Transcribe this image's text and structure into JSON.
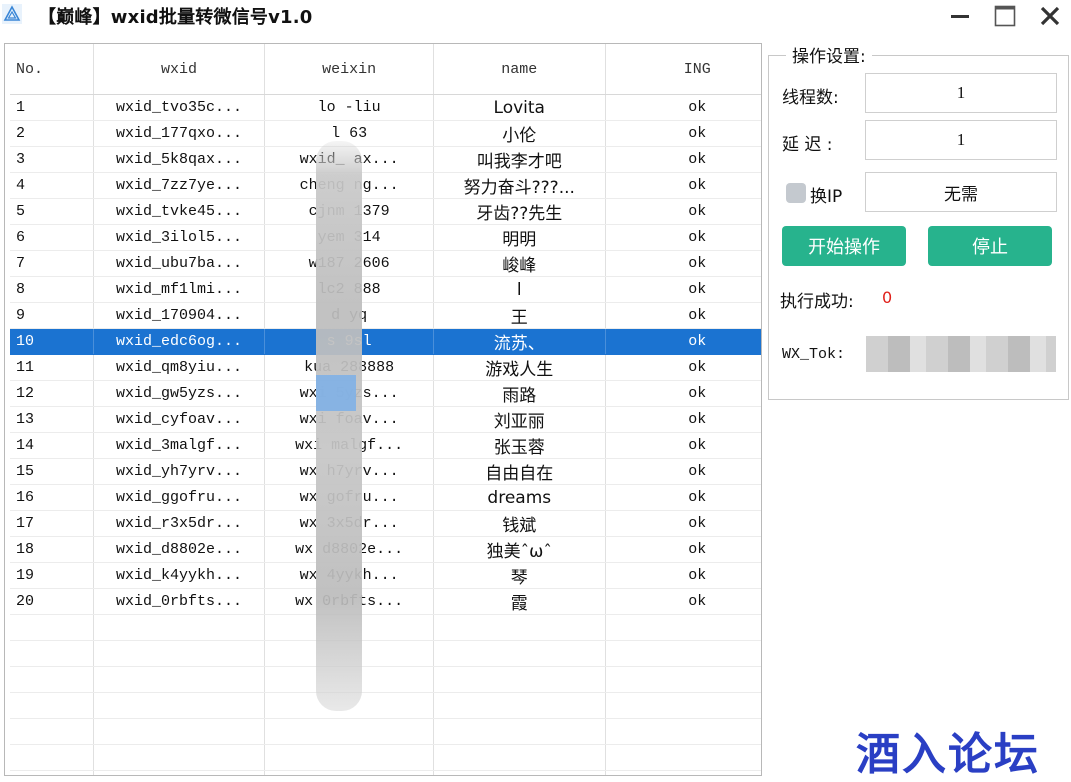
{
  "window": {
    "title": "【巅峰】wxid批量转微信号v1.0",
    "minimize_glyph": "—",
    "maximize_glyph": "☐",
    "close_glyph": "✕"
  },
  "table": {
    "columns": [
      "No.",
      "wxid",
      "weixin",
      "name",
      "ING"
    ],
    "selected_row": 10,
    "rows": [
      {
        "no": "1",
        "wxid": "wxid_tvo35c...",
        "weixin": "lo    -liu",
        "name": "Lovita",
        "ing": "ok"
      },
      {
        "no": "2",
        "wxid": "wxid_177qxo...",
        "weixin": "l    63",
        "name": "小伦",
        "ing": "ok"
      },
      {
        "no": "3",
        "wxid": "wxid_5k8qax...",
        "weixin": "wxid_    ax...",
        "name": "叫我李才吧",
        "ing": "ok"
      },
      {
        "no": "4",
        "wxid": "wxid_7zz7ye...",
        "weixin": "cheng    ng...",
        "name": "努力奋斗???...",
        "ing": "ok"
      },
      {
        "no": "5",
        "wxid": "wxid_tvke45...",
        "weixin": "cjnm    1379",
        "name": "牙齿??先生",
        "ing": "ok"
      },
      {
        "no": "6",
        "wxid": "wxid_3ilol5...",
        "weixin": "yem    314",
        "name": "明明",
        "ing": "ok"
      },
      {
        "no": "7",
        "wxid": "wxid_ubu7ba...",
        "weixin": "w187    2606",
        "name": "峻峰",
        "ing": "ok"
      },
      {
        "no": "8",
        "wxid": "wxid_mf1lmi...",
        "weixin": "lc2    888",
        "name": "l",
        "ing": "ok"
      },
      {
        "no": "9",
        "wxid": "wxid_170904...",
        "weixin": "d    yq",
        "name": "王",
        "ing": "ok"
      },
      {
        "no": "10",
        "wxid": "wxid_edc6og...",
        "weixin": "s    9sl",
        "name": "流苏、",
        "ing": "ok"
      },
      {
        "no": "11",
        "wxid": "wxid_qm8yiu...",
        "weixin": "kua    288888",
        "name": "游戏人生",
        "ing": "ok"
      },
      {
        "no": "12",
        "wxid": "wxid_gw5yzs...",
        "weixin": "wxi    5yzs...",
        "name": "雨路",
        "ing": "ok"
      },
      {
        "no": "13",
        "wxid": "wxid_cyfoav...",
        "weixin": "wxi    foav...",
        "name": "刘亚丽",
        "ing": "ok"
      },
      {
        "no": "14",
        "wxid": "wxid_3malgf...",
        "weixin": "wxi    malgf...",
        "name": "张玉蓉",
        "ing": "ok"
      },
      {
        "no": "15",
        "wxid": "wxid_yh7yrv...",
        "weixin": "wx    h7yrv...",
        "name": "自由自在",
        "ing": "ok"
      },
      {
        "no": "16",
        "wxid": "wxid_ggofru...",
        "weixin": "wx    gofru...",
        "name": "dreams",
        "ing": "ok"
      },
      {
        "no": "17",
        "wxid": "wxid_r3x5dr...",
        "weixin": "wx    3x5dr...",
        "name": "钱斌",
        "ing": "ok"
      },
      {
        "no": "18",
        "wxid": "wxid_d8802e...",
        "weixin": "wx    d8802e...",
        "name": "独美ˆωˆ",
        "ing": "ok"
      },
      {
        "no": "19",
        "wxid": "wxid_k4yykh...",
        "weixin": "wx    4yykh...",
        "name": "琴",
        "ing": "ok"
      },
      {
        "no": "20",
        "wxid": "wxid_0rbfts...",
        "weixin": "wx    0rbfts...",
        "name": "霞",
        "ing": "ok"
      }
    ]
  },
  "settings": {
    "legend": "操作设置:",
    "threads_label": "线程数:",
    "threads_value": "1",
    "delay_label": "延 迟 :",
    "delay_value": "1",
    "ip_label": "换IP",
    "ip_checked": false,
    "ip_value": "无需",
    "start_button": "开始操作",
    "stop_button": "停止",
    "success_label": "执行成功:",
    "success_count": "0",
    "token_label": "WX_Tok:"
  },
  "watermark": "酒入论坛",
  "colors": {
    "accent_green": "#27b38d",
    "selection_blue": "#1b73d1",
    "success_red": "#e0201a",
    "watermark_blue": "#2a3fc4"
  }
}
